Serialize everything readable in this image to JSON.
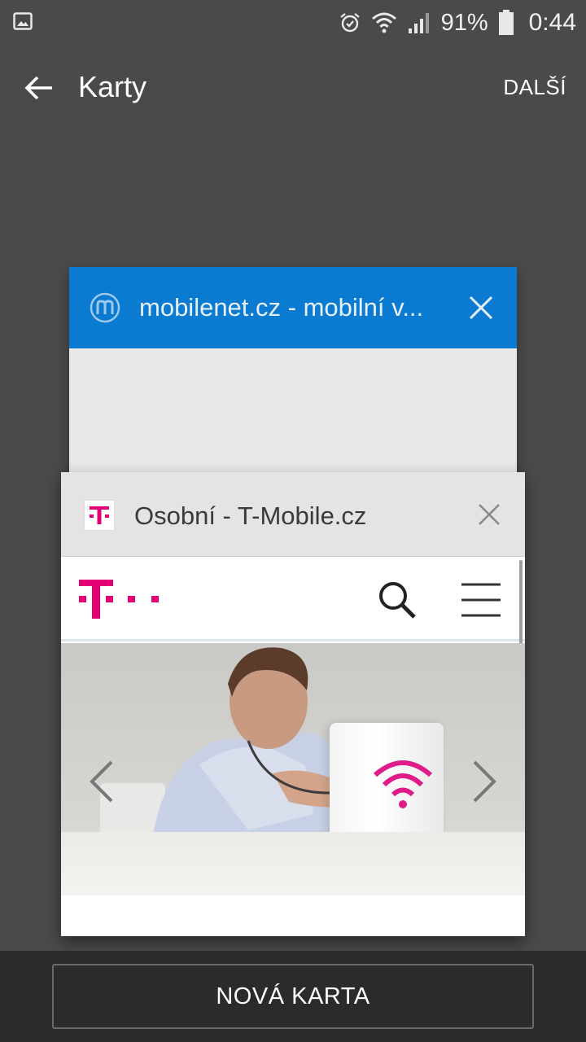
{
  "status_bar": {
    "icons": [
      "gallery-icon",
      "alarm-icon",
      "wifi-icon",
      "signal-icon",
      "battery-icon"
    ],
    "battery_percent": "91%",
    "time": "0:44"
  },
  "app_bar": {
    "back_icon": "arrow-back-icon",
    "title": "Karty",
    "more_label": "DALŠÍ"
  },
  "tabs": [
    {
      "title": "mobilenet.cz - mobilní v...",
      "favicon": "mobilenet-logo",
      "header_color": "#0a7bd1"
    },
    {
      "title": "Osobní - T-Mobile.cz",
      "favicon": "t-mobile-logo",
      "preview": {
        "brand_color": "#e20074",
        "icons": [
          "search-icon",
          "hamburger-menu-icon",
          "chevron-left-icon",
          "chevron-right-icon"
        ]
      }
    }
  ],
  "bottom_bar": {
    "new_tab_label": "NOVÁ KARTA"
  }
}
